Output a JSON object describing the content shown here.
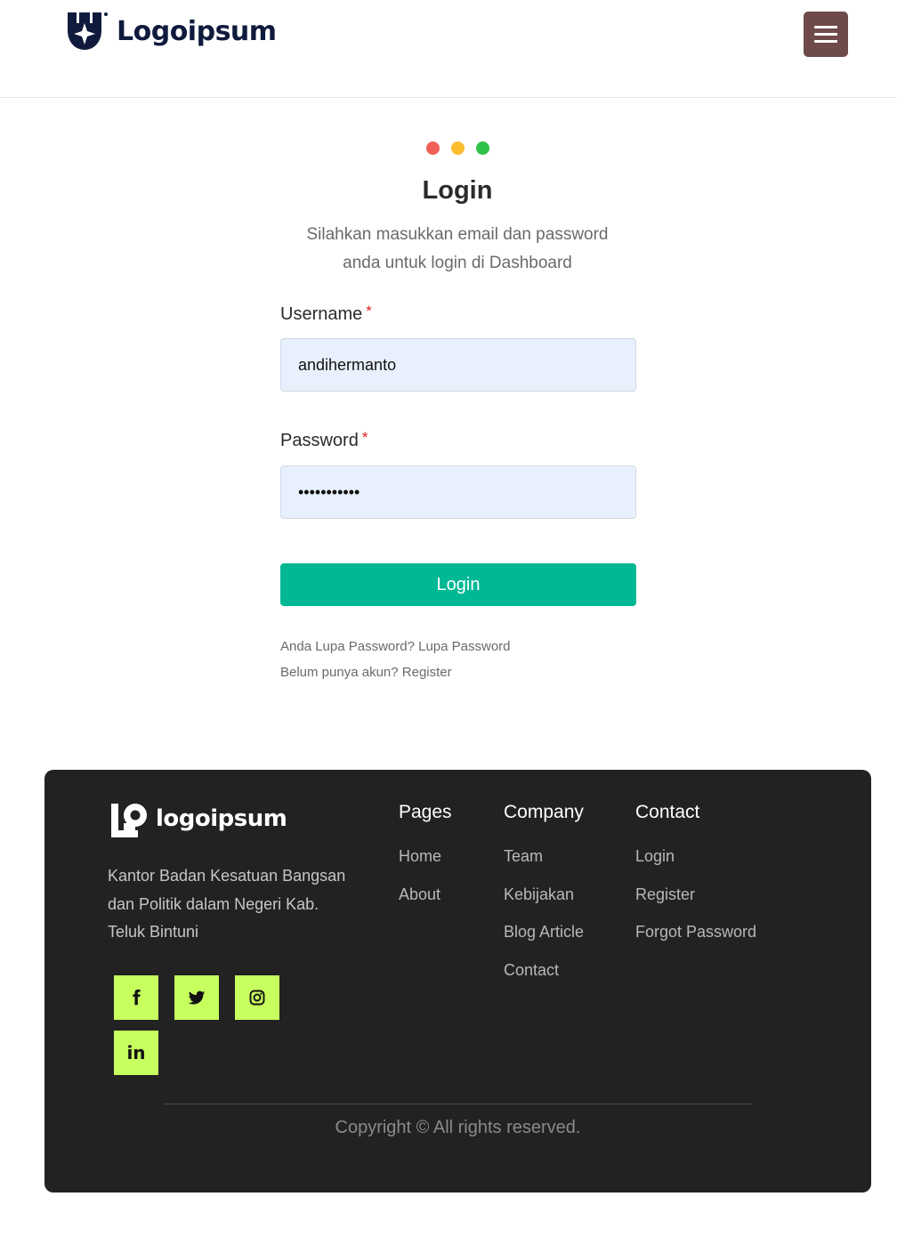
{
  "header": {
    "brand_name": "Logoipsum",
    "menu_icon": "hamburger-menu-icon",
    "menu_color": "#6e4a4a"
  },
  "window_dots": {
    "colors": [
      "#f25f58",
      "#fbbc2e",
      "#30c248"
    ]
  },
  "login": {
    "title": "Login",
    "subtitle_line1": "Silahkan masukkan email dan password",
    "subtitle_line2": "anda untuk login di Dashboard",
    "username_label": "Username",
    "username_value": "andihermanto",
    "password_label": "Password",
    "password_value": "andihermant",
    "required_mark": "*",
    "submit_label": "Login",
    "forgot_prefix": "Anda Lupa Password?",
    "forgot_link": "Lupa Password",
    "register_prefix": "Belum punya akun?",
    "register_link": "Register",
    "accent_color": "#00b894"
  },
  "footer": {
    "brand_name": "logoipsum",
    "address": "Kantor Badan Kesatuan Bangsan dan Politik dalam Negeri Kab. Teluk Bintuni",
    "socials": [
      {
        "icon": "facebook-icon"
      },
      {
        "icon": "twitter-icon"
      },
      {
        "icon": "instagram-icon"
      },
      {
        "icon": "linkedin-icon",
        "text": "in"
      }
    ],
    "social_color": "#c6ff5e",
    "columns": [
      {
        "title": "Pages",
        "links": [
          "Home",
          "About"
        ]
      },
      {
        "title": "Company",
        "links": [
          "Team",
          "Kebijakan",
          "Blog Article",
          "Contact"
        ]
      },
      {
        "title": "Contact",
        "links": [
          "Login",
          "Register",
          "Forgot Password"
        ]
      }
    ],
    "copyright": "Copyright © All rights reserved."
  }
}
